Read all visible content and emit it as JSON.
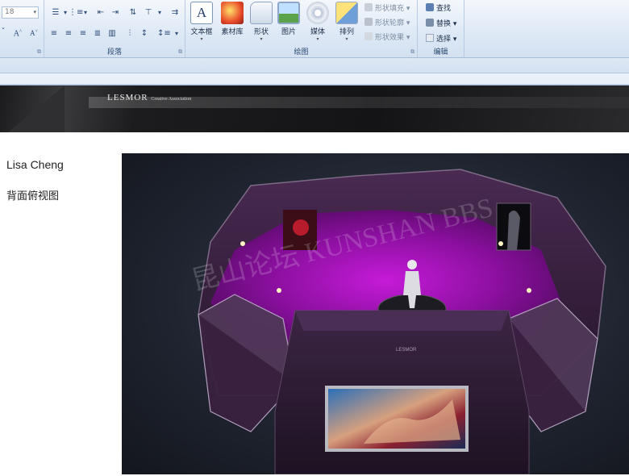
{
  "ribbon": {
    "font_size_value": "18",
    "groups": {
      "paragraph": {
        "label": "段落"
      },
      "drawing": {
        "label": "绘图"
      },
      "editing": {
        "label": "编辑"
      }
    },
    "buttons": {
      "textbox": "文本框",
      "material": "素材库",
      "shape": "形状",
      "picture": "图片",
      "media": "媒体",
      "arrange": "排列"
    },
    "shape_fill": "形状填充",
    "shape_outline": "形状轮廓",
    "shape_effect": "形状效果",
    "find": "查找",
    "replace": "替换",
    "select": "选择"
  },
  "banner": {
    "brand": "LESMOR",
    "tagline": "Creative Association"
  },
  "content": {
    "author": "Lisa Cheng",
    "view_title": "背面俯视图"
  },
  "photo": {
    "watermark": "昆山论坛 KUNSHAN BBS",
    "panel_small_text": "LESMOR"
  },
  "colors": {
    "ribbon_bg": "#dde8f5",
    "accent_purple": "#a010c8",
    "booth_dark": "#2a1830"
  }
}
